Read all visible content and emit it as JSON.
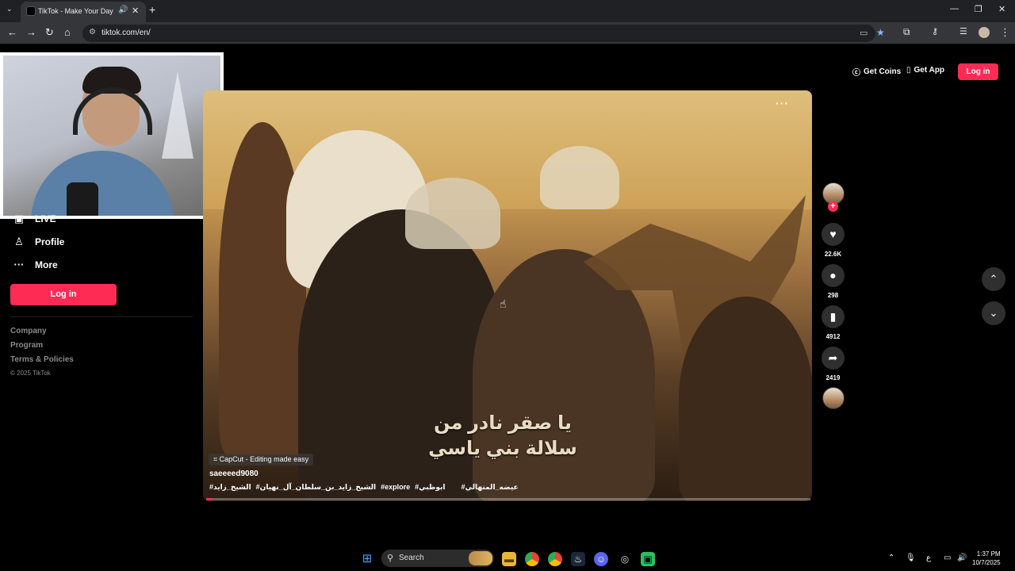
{
  "browser": {
    "tab_title": "TikTok - Make Your Day",
    "url": "tiktok.com/en/",
    "accent_color": "#8ab4f8"
  },
  "sidebar": {
    "items": [
      {
        "label": "LIVE",
        "icon": "live-icon"
      },
      {
        "label": "Profile",
        "icon": "profile-icon"
      },
      {
        "label": "More",
        "icon": "more-icon"
      }
    ],
    "login_label": "Log in",
    "footer_links": [
      "Company",
      "Program",
      "Terms & Policies"
    ],
    "copyright": "© 2025 TikTok"
  },
  "header": {
    "get_coins": "Get Coins",
    "get_app": "Get App",
    "login": "Log in",
    "brand_color": "#fe2c55"
  },
  "video": {
    "caption_line1": "يا صقر نادر من",
    "caption_line2": "سلالة بني ياسي",
    "capcut_label": "CapCut - Editing made easy",
    "username": "saeeeed9080",
    "hashtags": [
      "#الشيخ_زايد",
      "#الشيخ_زايد_بن_سلطان_آل_نهيان",
      "#explore",
      "#ابوظبي",
      "#عيضه_المنهالي"
    ],
    "progress": 0.01
  },
  "actions": {
    "likes": "22.6K",
    "comments": "298",
    "saves": "4912",
    "shares": "2419"
  },
  "taskbar": {
    "search_label": "Search",
    "time": "1:37 PM",
    "date": "10/7/2025"
  }
}
